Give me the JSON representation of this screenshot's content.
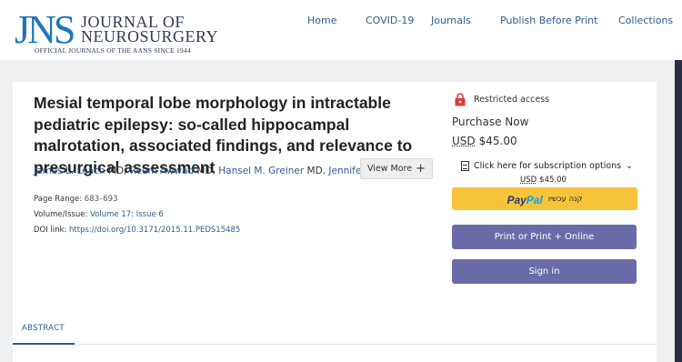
{
  "logo": {
    "mark": "JNS",
    "line1": "JOURNAL OF",
    "line2": "NEUROSURGERY",
    "tagline": "OFFICIAL JOURNALS OF THE AANS SINCE 1944"
  },
  "nav": {
    "items": [
      "Home",
      "COVID-19",
      "Journals",
      "Publish Before Print",
      "Collections"
    ]
  },
  "article": {
    "title": "Mesial temporal lobe morphology in intractable pediatric epilepsy: so-called hippocampal malrotation, associated findings, and relevance to presurgical assessment",
    "authors": [
      {
        "name": "James L. Leach",
        "degree": "MD"
      },
      {
        "name": "Reem Awwad",
        "degree": "MD"
      },
      {
        "name": "Hansel M. Greiner",
        "degree": "MD"
      },
      {
        "name": "Jennife..."
      }
    ],
    "view_more": "View More",
    "meta": {
      "page_range_label": "Page Range:",
      "page_range": "683–693",
      "volume_label": "Volume/Issue:",
      "volume": "Volume 17: Issue 6",
      "doi_label": "DOI link:",
      "doi": "https://doi.org/10.3171/2015.11.PEDS15485"
    }
  },
  "purchase": {
    "restricted": "Restricted access",
    "heading": "Purchase Now",
    "currency": "USD",
    "price": "$45.00",
    "subscription_options": "Click here for subscription options",
    "sub_currency": "USD",
    "sub_price": "$45.00",
    "paypal_brand_1": "Pay",
    "paypal_brand_2": "Pal",
    "paypal_hebrew": "קנה עכשיו",
    "print_button": "Print or Print + Online",
    "signin_button": "Sign in"
  },
  "tabs": {
    "abstract": "ABSTRACT"
  },
  "colors": {
    "link": "#2c5d8f",
    "button_purple": "#6b6baa",
    "paypal_yellow": "#f7c439",
    "page_bg": "#eef0f2"
  }
}
